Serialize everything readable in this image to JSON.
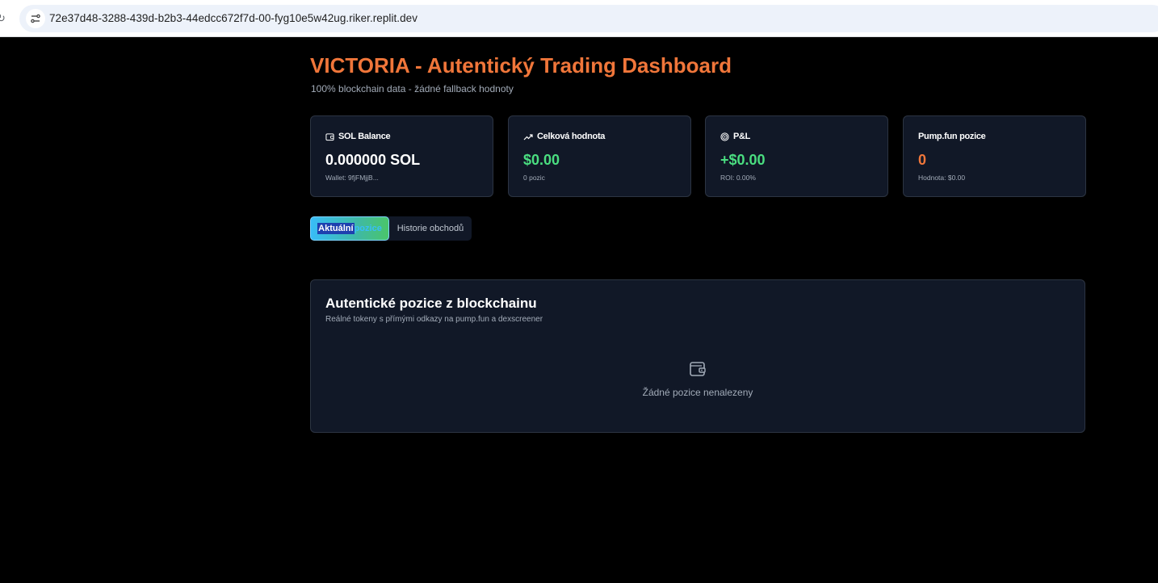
{
  "browser": {
    "url": "72e37d48-3288-439d-b2b3-44edcc672f7d-00-fyg10e5w42ug.riker.replit.dev",
    "reload_glyph": "↻"
  },
  "header": {
    "title": "VICTORIA - Autentický Trading Dashboard",
    "subtitle": "100% blockchain data - žádné fallback hodnoty"
  },
  "cards": [
    {
      "icon": "wallet-icon",
      "label": "SOL Balance",
      "value": "0.000000 SOL",
      "sub": "Wallet: 9fjFMjjB...",
      "value_color": "#ffffff"
    },
    {
      "icon": "trending-up-icon",
      "label": "Celková hodnota",
      "value": "$0.00",
      "sub": "0 pozic",
      "value_color": "#4ade80"
    },
    {
      "icon": "target-icon",
      "label": "P&L",
      "value": "+$0.00",
      "sub": "ROI: 0.00%",
      "value_color": "#4ade80"
    },
    {
      "icon": "",
      "label": "Pump.fun pozice",
      "value": "0",
      "sub": "Hodnota: $0.00",
      "value_color": "#f0763a"
    }
  ],
  "tabs": {
    "active_selected": "Aktuální",
    "active_rest": " pozice",
    "history": "Historie obchodů"
  },
  "positions": {
    "title": "Autentické pozice z blockchainu",
    "subtitle": "Reálné tokeny s přímými odkazy na pump.fun a dexscreener",
    "empty_text": "Žádné pozice nenalezeny"
  },
  "colors": {
    "accent": "#f0763a",
    "positive": "#4ade80",
    "card_bg": "#111827",
    "border": "#2c3442"
  }
}
